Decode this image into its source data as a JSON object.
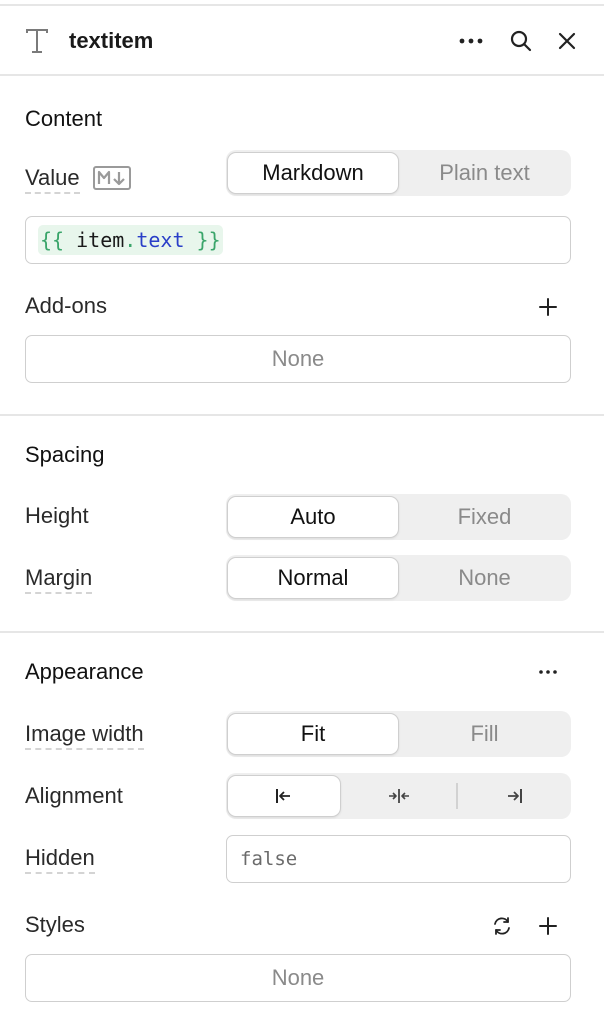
{
  "header": {
    "title": "textitem",
    "type_icon": "text-type-icon",
    "more_icon": "more-horizontal-icon",
    "search_icon": "search-icon",
    "close_icon": "close-icon"
  },
  "content": {
    "section_title": "Content",
    "value_label": "Value",
    "value_badge_icon": "markdown-icon",
    "value_mode": {
      "options": [
        "Markdown",
        "Plain text"
      ],
      "selected": "Markdown"
    },
    "value_code": {
      "open": "{{ ",
      "ident": "item",
      "dot": ".",
      "prop": "text",
      "close": " }}"
    },
    "addons_label": "Add-ons",
    "addons_value": "None"
  },
  "spacing": {
    "section_title": "Spacing",
    "height_label": "Height",
    "height": {
      "options": [
        "Auto",
        "Fixed"
      ],
      "selected": "Auto"
    },
    "margin_label": "Margin",
    "margin": {
      "options": [
        "Normal",
        "None"
      ],
      "selected": "Normal"
    }
  },
  "appearance": {
    "section_title": "Appearance",
    "image_width_label": "Image width",
    "image_width": {
      "options": [
        "Fit",
        "Fill"
      ],
      "selected": "Fit"
    },
    "alignment_label": "Alignment",
    "alignment": {
      "options": [
        "align-left-icon",
        "align-center-icon",
        "align-right-icon"
      ],
      "selected": "align-left-icon"
    },
    "hidden_label": "Hidden",
    "hidden_value": "false",
    "styles_label": "Styles",
    "styles_value": "None"
  },
  "colors": {
    "code_bg": "#e8f6ec",
    "code_brace": "#3aa56a",
    "code_prop": "#2a3fc8",
    "divider": "#e6e6e6"
  }
}
